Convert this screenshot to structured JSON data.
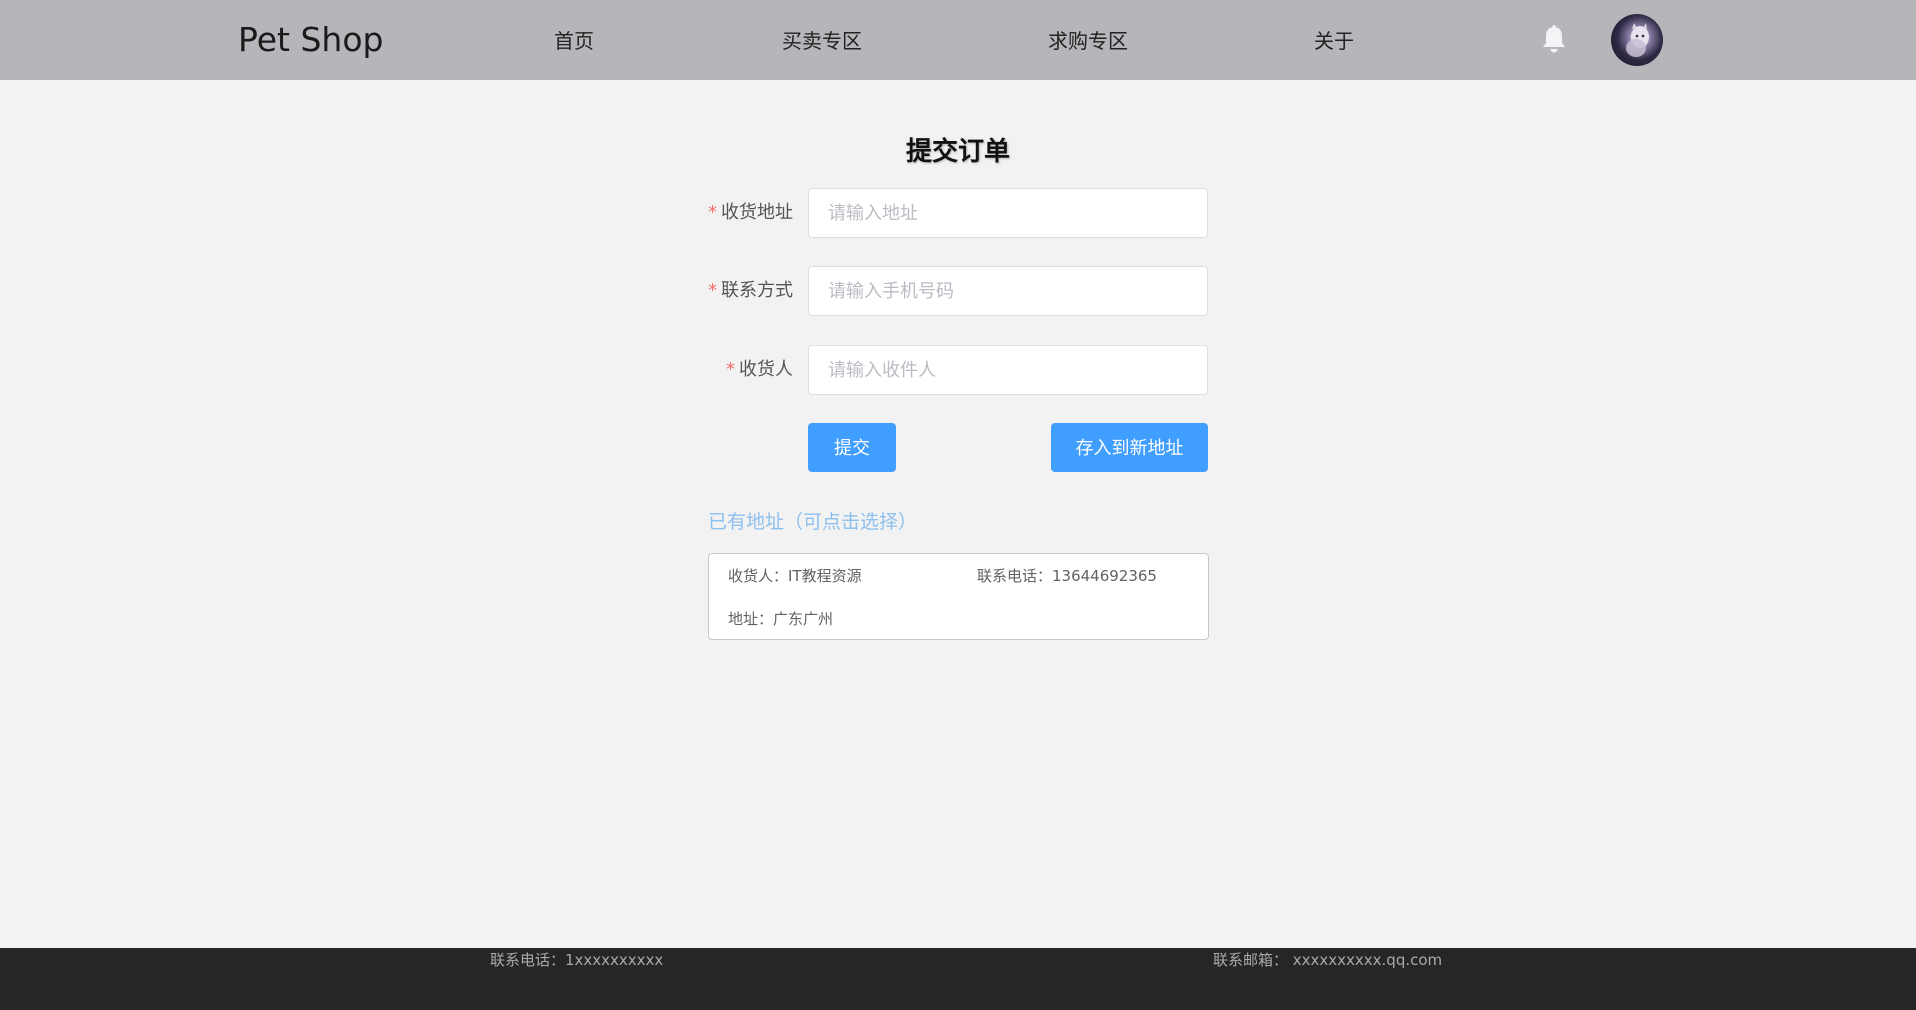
{
  "header": {
    "brand": "Pet Shop",
    "nav": [
      "首页",
      "买卖专区",
      "求购专区",
      "关于"
    ]
  },
  "form": {
    "title": "提交订单",
    "required_mark": "*",
    "fields": [
      {
        "label": "收货地址",
        "placeholder": "请输入地址",
        "value": ""
      },
      {
        "label": "联系方式",
        "placeholder": "请输入手机号码",
        "value": ""
      },
      {
        "label": "收货人",
        "placeholder": "请输入收件人",
        "value": ""
      }
    ],
    "submit_label": "提交",
    "save_label": "存入到新地址"
  },
  "existing": {
    "title": "已有地址（可点击选择）",
    "addresses": [
      {
        "receiver": "收货人：IT教程资源",
        "phone": "联系电话：13644692365",
        "address": "地址：广东广州"
      }
    ]
  },
  "footer": {
    "phone": "联系电话：1xxxxxxxxxx",
    "email": "联系邮箱： xxxxxxxxxx.qq.com"
  },
  "icons": {
    "bell": "bell-icon",
    "avatar": "avatar"
  },
  "colors": {
    "header_bg": "#b6b6ba",
    "primary": "#409eff",
    "link_light": "#8ec0ef",
    "required": "#f56c6c",
    "footer_bg": "#262626"
  }
}
